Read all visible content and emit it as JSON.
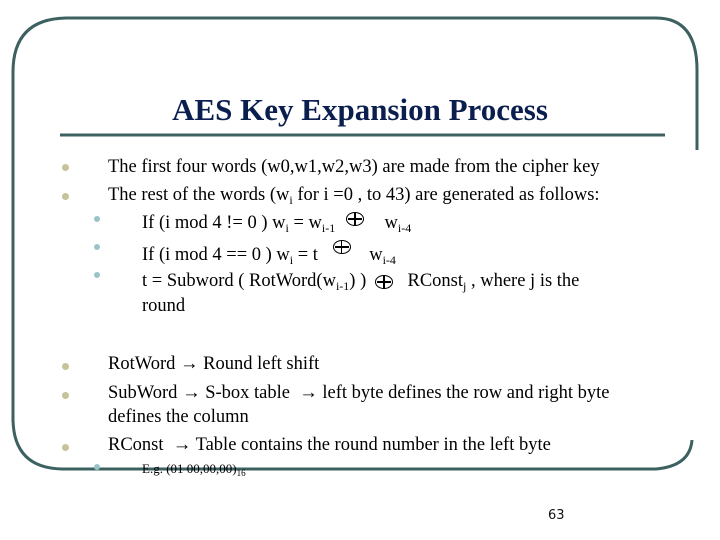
{
  "slide": {
    "title": "AES Key Expansion Process",
    "page_number": "63",
    "colors": {
      "title": "#0b1f4f",
      "frame": "#3d6060",
      "bullet_level1": "#c6c39a",
      "bullet_level2": "#98c4c8"
    },
    "xor_symbol": "xor-circle-plus",
    "arrow_symbol": "→",
    "bullets": [
      {
        "level": 1,
        "text": "The first four words (w0,w1,w2,w3) are made from  the cipher key"
      },
      {
        "level": 1,
        "pre": "The rest of the words (w",
        "sub": "i",
        "post": " for i =0 , to 43)  are generated as follows:"
      },
      {
        "level": 2,
        "pre": "If (i mod 4 != 0 ) w",
        "sub1": "i",
        "mid": " = w",
        "sub2": "i-1",
        "post": "w",
        "sub3": "i-4"
      },
      {
        "level": 2,
        "pre": "If (i mod 4 == 0 ) w",
        "sub1": "i",
        "mid": " = t",
        "post": "w",
        "sub3": "i-4"
      },
      {
        "level": 2,
        "pre": "t = Subword ( RotWord(w",
        "sub1": "i-1",
        "mid": ") )",
        "post": "RConst",
        "sub2": "j",
        "tail": " , where  j is the",
        "line2": "round"
      },
      {
        "level": 1,
        "pre": "RotWord",
        "post": "Round left shift"
      },
      {
        "level": 1,
        "pre": "SubWord",
        "mid": "S-box table",
        "post": "left byte defines the row and right byte",
        "line2": "defines the column"
      },
      {
        "level": 1,
        "pre": "RConst",
        "post": "Table contains the round number in the left  byte"
      },
      {
        "level": 2,
        "pre": "E.g. (01 00,00,00)",
        "sub": "16"
      }
    ]
  }
}
